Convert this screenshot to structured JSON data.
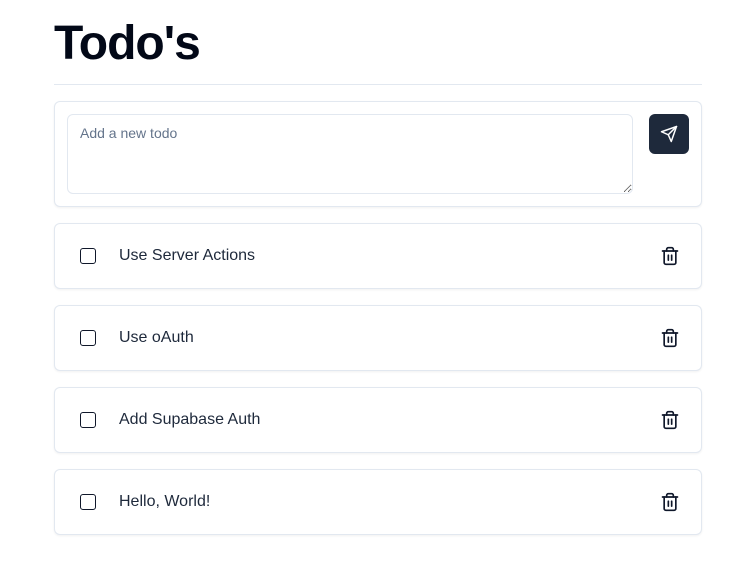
{
  "page": {
    "title": "Todo's"
  },
  "form": {
    "placeholder": "Add a new todo",
    "value": "",
    "submit_icon": "send-icon"
  },
  "todos": [
    {
      "label": "Use Server Actions",
      "completed": false,
      "delete_icon": "trash-icon"
    },
    {
      "label": "Use oAuth",
      "completed": false,
      "delete_icon": "trash-icon"
    },
    {
      "label": "Add Supabase Auth",
      "completed": false,
      "delete_icon": "trash-icon"
    },
    {
      "label": "Hello, World!",
      "completed": false,
      "delete_icon": "trash-icon"
    }
  ],
  "colors": {
    "text": "#020817",
    "border": "#e2e8f0",
    "button_bg": "#1e293b",
    "placeholder": "#64748b"
  }
}
